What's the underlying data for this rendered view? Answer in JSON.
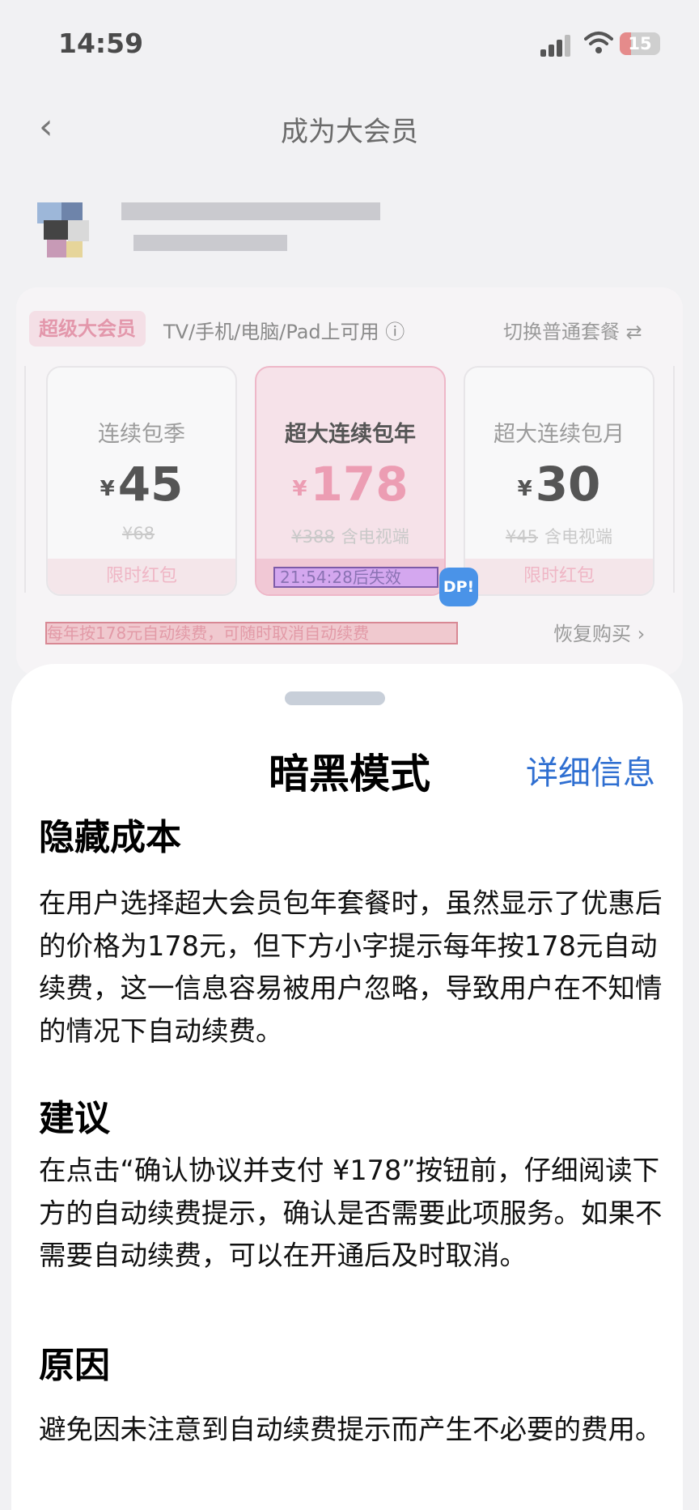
{
  "status": {
    "time": "14:59",
    "battery": "15"
  },
  "nav": {
    "title": "成为大会员"
  },
  "membership": {
    "tag": "超级大会员",
    "available": "TV/手机/电脑/Pad上可用 ⓘ",
    "switch_label": "切换普通套餐 ⇄",
    "plans": [
      {
        "name": "连续包季",
        "currency": "¥",
        "price": "45",
        "original": "¥68",
        "extra": "",
        "promo": "限时红包"
      },
      {
        "name": "超大连续包年",
        "currency": "¥",
        "price": "178",
        "original": "¥388",
        "extra": "含电视端",
        "promo": "21:54:28后失效"
      },
      {
        "name": "超大连续包月",
        "currency": "¥",
        "price": "30",
        "original": "¥45",
        "extra": "含电视端",
        "promo": "限时红包"
      }
    ],
    "badge": "DP!",
    "renew_notice": "每年按178元自动续费，可随时取消自动续费",
    "restore_label": "恢复购买 ›"
  },
  "sheet": {
    "title": "暗黑模式",
    "detail_link": "详细信息",
    "sections": [
      {
        "heading": "隐藏成本",
        "body": "在用户选择超大会员包年套餐时，虽然显示了优惠后的价格为178元，但下方小字提示每年按178元自动续费，这一信息容易被用户忽略，导致用户在不知情的情况下自动续费。"
      },
      {
        "heading": "建议",
        "body": "在点击“确认协议并支付 ¥178”按钮前，仔细阅读下方的自动续费提示，确认是否需要此项服务。如果不需要自动续费，可以在开通后及时取消。"
      },
      {
        "heading": "原因",
        "body": "避免因未注意到自动续费提示而产生不必要的费用。"
      }
    ]
  }
}
